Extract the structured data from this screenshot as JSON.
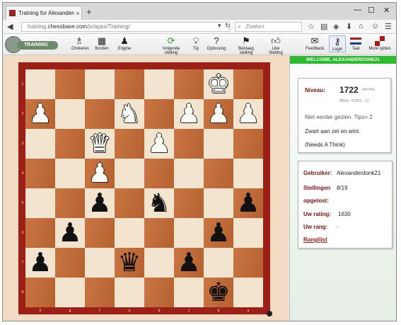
{
  "browser": {
    "tab_title": "Training for Alexanderdo...",
    "tab_close": "×",
    "new_tab": "+",
    "win_minimize": "—",
    "win_maximize": "☐",
    "win_close": "✕",
    "url_prefix": "training.",
    "url_domain": "chessbase.com",
    "url_path": "/js/apps/Training/",
    "search_placeholder": "Zoeken"
  },
  "toolbar": {
    "logo_label": "TRAINING",
    "items": [
      {
        "label": "Omkeren"
      },
      {
        "label": "Borden"
      },
      {
        "label": "Engine"
      },
      {
        "label": "Volgende stelling"
      },
      {
        "label": "Tip"
      },
      {
        "label": "Oplossing"
      },
      {
        "label": "Beklaag stelling"
      },
      {
        "label": "Like Stelling"
      },
      {
        "label": "Feedback"
      },
      {
        "label": "Login"
      },
      {
        "label": "Taal"
      },
      {
        "label": "More opties"
      }
    ]
  },
  "board": {
    "files": [
      "h",
      "g",
      "f",
      "e",
      "d",
      "c",
      "b",
      "a"
    ],
    "ranks": [
      "1",
      "2",
      "3",
      "4",
      "5",
      "6",
      "7",
      "8"
    ],
    "pieces": [
      {
        "glyph": "♚",
        "color": "w",
        "square": "b1",
        "name": "white-king"
      },
      {
        "glyph": "♟",
        "color": "w",
        "square": "h2",
        "name": "white-pawn-h2"
      },
      {
        "glyph": "♞",
        "color": "w",
        "square": "e2",
        "name": "white-knight"
      },
      {
        "glyph": "♟",
        "color": "w",
        "square": "c2",
        "name": "white-pawn-c2"
      },
      {
        "glyph": "♟",
        "color": "w",
        "square": "b2",
        "name": "white-pawn-b2"
      },
      {
        "glyph": "♟",
        "color": "w",
        "square": "a2",
        "name": "white-pawn-a2"
      },
      {
        "glyph": "♛",
        "color": "w",
        "square": "f3",
        "name": "white-queen"
      },
      {
        "glyph": "♟",
        "color": "w",
        "square": "d3",
        "name": "white-pawn-d3"
      },
      {
        "glyph": "♟",
        "color": "w",
        "square": "f4",
        "name": "white-pawn-f4"
      },
      {
        "glyph": "♟",
        "color": "b",
        "square": "f5",
        "name": "black-pawn-f5"
      },
      {
        "glyph": "♞",
        "color": "b",
        "square": "d5",
        "name": "black-knight"
      },
      {
        "glyph": "♟",
        "color": "b",
        "square": "a5",
        "name": "black-pawn-a5"
      },
      {
        "glyph": "♟",
        "color": "b",
        "square": "g6",
        "name": "black-pawn-g6"
      },
      {
        "glyph": "♟",
        "color": "b",
        "square": "b6",
        "name": "black-pawn-b6"
      },
      {
        "glyph": "♟",
        "color": "b",
        "square": "h7",
        "name": "black-pawn-h7"
      },
      {
        "glyph": "♛",
        "color": "b",
        "square": "e7",
        "name": "black-queen"
      },
      {
        "glyph": "♟",
        "color": "b",
        "square": "c7",
        "name": "black-pawn-c7"
      },
      {
        "glyph": "♚",
        "color": "b",
        "square": "b8",
        "name": "black-king"
      }
    ]
  },
  "panel": {
    "welcome": "WELCOME, ALEXANDERDONK21",
    "niveau_label": "Niveau:",
    "rating": "1722",
    "rating_n": "(N=431,",
    "rating_stats": "Ø99s, #2951, -1)",
    "not_seen": "Niet eerder gezien. Tips= 2",
    "task": "Zwart aan zet en wint.",
    "note": "(Needs A Think)",
    "user_label": "Gebruiker:",
    "user_value": "Alexanderdonk21",
    "solved_label1": "Stellingen",
    "solved_label2": "opgelost:",
    "solved_value": "8/19",
    "your_rating_label": "Uw rating:",
    "your_rating_value": "1630",
    "rank_label": "Uw rang:",
    "rank_value": "-",
    "ranking_link": "Ranglijst"
  }
}
